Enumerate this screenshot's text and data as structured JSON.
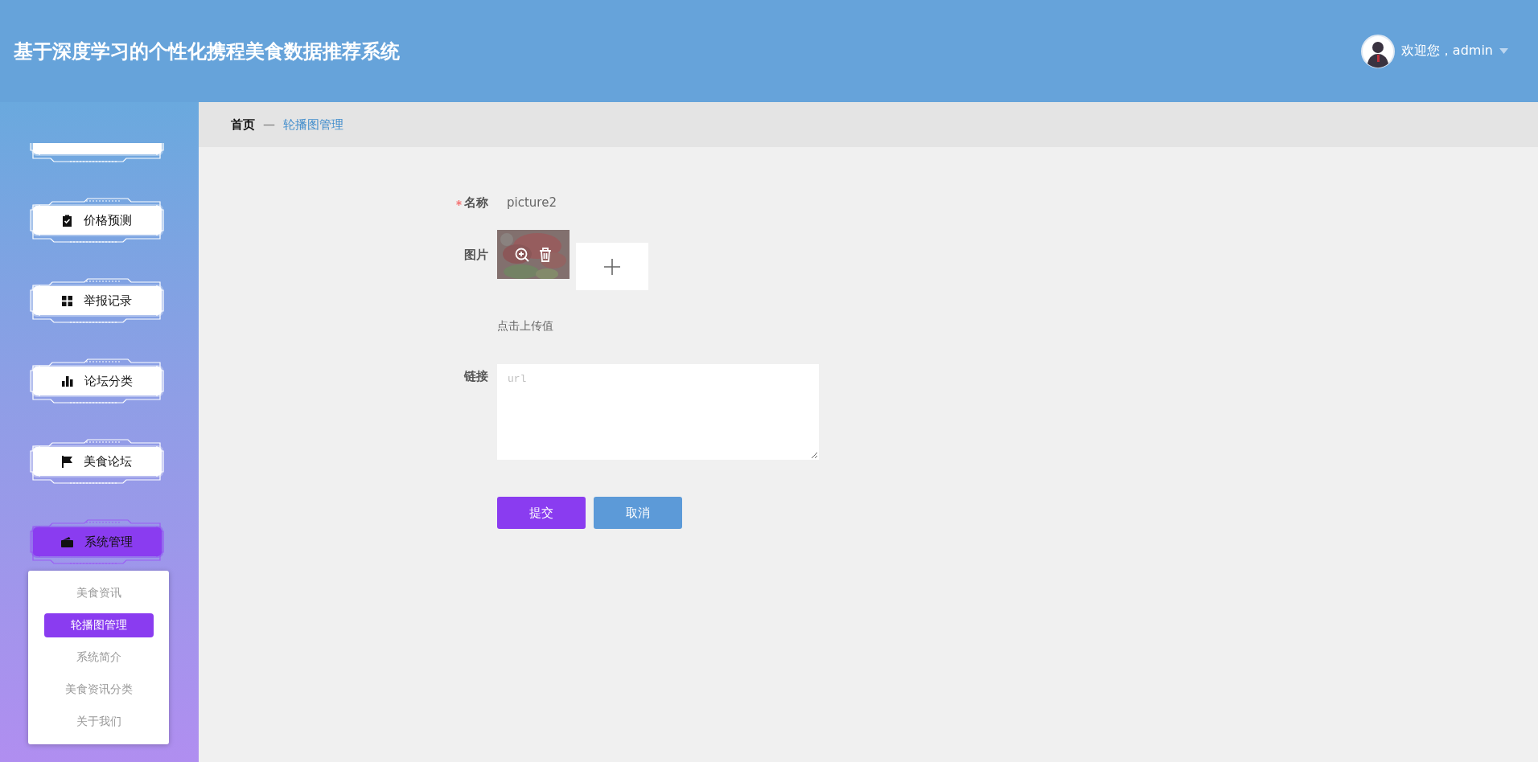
{
  "header": {
    "title": "基于深度学习的个性化携程美食数据推荐系统",
    "user": {
      "greeting": "欢迎您，admin"
    }
  },
  "sidebar": {
    "items": [
      {
        "kind": "cut"
      },
      {
        "kind": "item",
        "label": "价格预测",
        "selected": false
      },
      {
        "kind": "item",
        "label": "举报记录",
        "selected": false
      },
      {
        "kind": "item",
        "label": "论坛分类",
        "selected": false
      },
      {
        "kind": "item",
        "label": "美食论坛",
        "selected": false
      },
      {
        "kind": "item",
        "label": "系统管理",
        "selected": true,
        "children": [
          {
            "label": "美食资讯",
            "selected": false
          },
          {
            "label": "轮播图管理",
            "selected": true
          },
          {
            "label": "系统简介",
            "selected": false
          },
          {
            "label": "美食资讯分类",
            "selected": false
          },
          {
            "label": "关于我们",
            "selected": false
          }
        ]
      }
    ]
  },
  "breadcrumb": {
    "home": "首页",
    "separator": "—",
    "current": "轮播图管理"
  },
  "form": {
    "fields": [
      {
        "kind": "text",
        "label": "名称",
        "required": true,
        "value": "picture2"
      },
      {
        "label": "图片",
        "required": false,
        "hint": "点击上传值"
      },
      {
        "kind": "textarea",
        "label": "链接",
        "required": false,
        "placeholder": "url"
      }
    ],
    "buttons": [
      {
        "label": "提交",
        "kind": "primary"
      },
      {
        "label": "取消",
        "kind": "secondary"
      }
    ]
  }
}
